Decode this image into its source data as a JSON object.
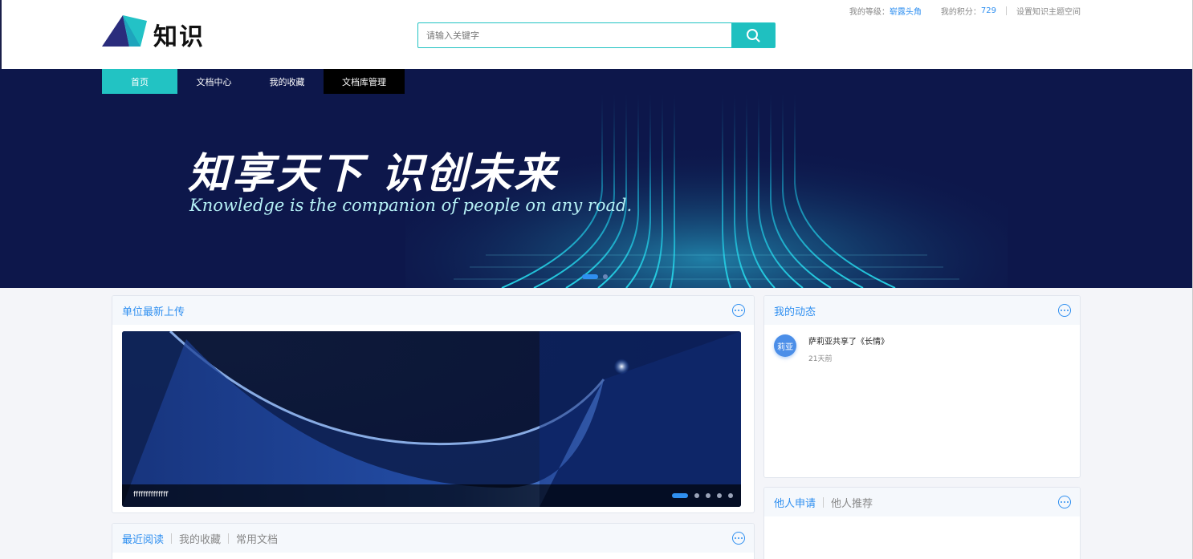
{
  "header": {
    "logo_text": "知识",
    "search": {
      "placeholder": "请输入关键字"
    },
    "top_links": {
      "level_label": "我的等级：",
      "level_value": "崭露头角",
      "points_label": "我的积分：",
      "points_value": "729",
      "settings_label": "设置知识主题空间"
    }
  },
  "nav": {
    "items": [
      {
        "label": "首页"
      },
      {
        "label": "文档中心"
      },
      {
        "label": "我的收藏"
      },
      {
        "label": "文档库管理"
      }
    ]
  },
  "banner": {
    "slogan_cn": "知享天下  识创未来",
    "slogan_en": "Knowledge is the companion of people on any road."
  },
  "latest_uploads": {
    "title": "单位最新上传",
    "caption": "ffffffffffffff"
  },
  "my_activity": {
    "title": "我的动态",
    "items": [
      {
        "avatar": "莉亚",
        "text": "萨莉亚共享了《长情》",
        "time": "21天前"
      }
    ]
  },
  "requests": {
    "tab1": "他人申请",
    "tab2": "他人推荐"
  },
  "reading": {
    "tab1": "最近阅读",
    "tab2": "我的收藏",
    "tab3": "常用文档"
  },
  "colors": {
    "accent": "#22c3c3",
    "link": "#2f8ff0",
    "banner_bg": "#0d174b"
  }
}
